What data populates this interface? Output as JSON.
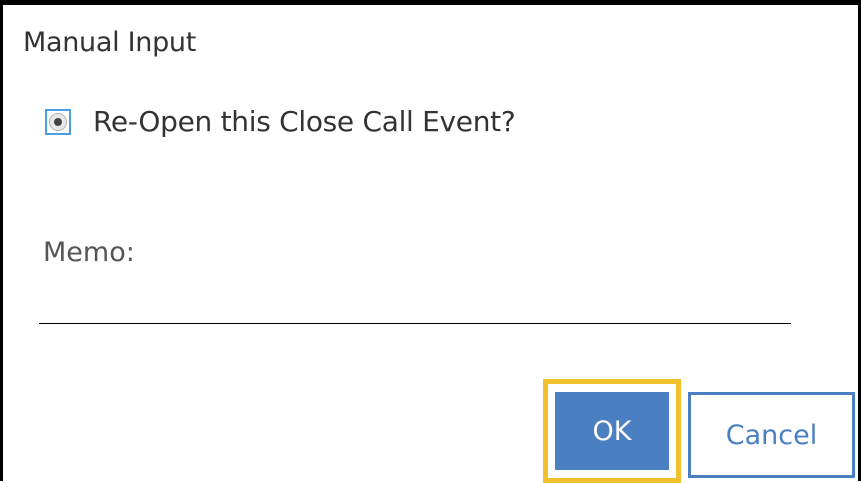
{
  "dialog": {
    "title": "Manual Input",
    "reopen_option": {
      "label": "Re-Open this Close Call Event?",
      "selected": true
    },
    "memo": {
      "label": "Memo:",
      "value": ""
    },
    "buttons": {
      "ok_label": "OK",
      "cancel_label": "Cancel"
    }
  },
  "colors": {
    "accent_blue": "#4a7fc1",
    "focus_highlight": "#f2c02a",
    "radio_focus": "#4a9fe0"
  }
}
